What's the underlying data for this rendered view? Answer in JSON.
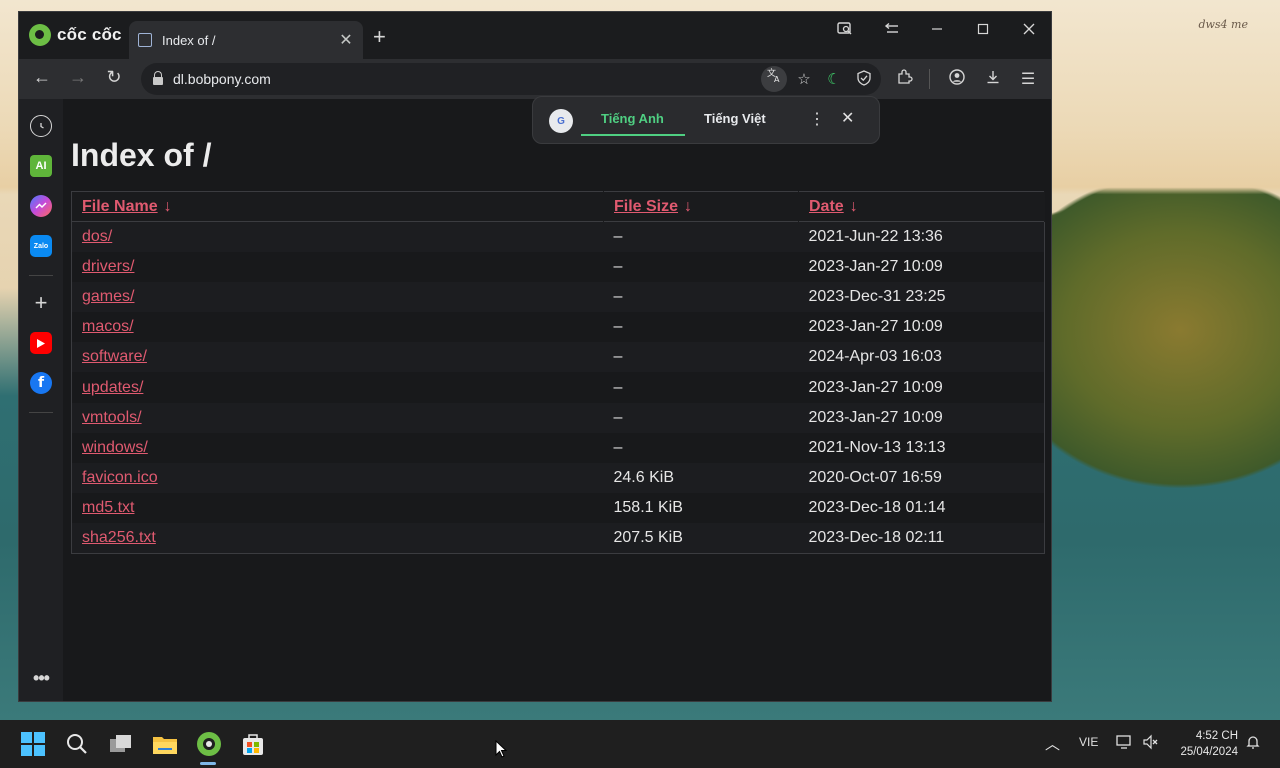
{
  "desktop": {
    "watermark": "dws4 me"
  },
  "browser": {
    "brand": "cốc cốc",
    "tab": {
      "title": "Index of /",
      "close": "✕"
    },
    "new_tab": "+",
    "url": "dl.bobpony.com"
  },
  "translate_popup": {
    "logo": "G",
    "tabs": [
      {
        "label": "Tiếng Anh",
        "active": true
      },
      {
        "label": "Tiếng Việt",
        "active": false
      }
    ]
  },
  "sidebar": {
    "ai_label": "AI",
    "zalo_label": "Zalo"
  },
  "page": {
    "title": "Index of /",
    "columns": [
      {
        "label": "File Name",
        "sort": "↓"
      },
      {
        "label": "File Size",
        "sort": "↓"
      },
      {
        "label": "Date",
        "sort": "↓"
      }
    ],
    "rows": [
      {
        "name": "dos/",
        "size": "–",
        "date": "2021-Jun-22 13:36"
      },
      {
        "name": "drivers/",
        "size": "–",
        "date": "2023-Jan-27 10:09"
      },
      {
        "name": "games/",
        "size": "–",
        "date": "2023-Dec-31 23:25"
      },
      {
        "name": "macos/",
        "size": "–",
        "date": "2023-Jan-27 10:09"
      },
      {
        "name": "software/",
        "size": "–",
        "date": "2024-Apr-03 16:03"
      },
      {
        "name": "updates/",
        "size": "–",
        "date": "2023-Jan-27 10:09"
      },
      {
        "name": "vmtools/",
        "size": "–",
        "date": "2023-Jan-27 10:09"
      },
      {
        "name": "windows/",
        "size": "–",
        "date": "2021-Nov-13 13:13"
      },
      {
        "name": "favicon.ico",
        "size": "24.6 KiB",
        "date": "2020-Oct-07 16:59"
      },
      {
        "name": "md5.txt",
        "size": "158.1 KiB",
        "date": "2023-Dec-18 01:14"
      },
      {
        "name": "sha256.txt",
        "size": "207.5 KiB",
        "date": "2023-Dec-18 02:11"
      }
    ]
  },
  "taskbar": {
    "language": "VIE",
    "time": "4:52 CH",
    "date": "25/04/2024"
  },
  "colors": {
    "link": "#e05a70",
    "translate_active": "#4fcf82",
    "page_bg": "#18191b"
  }
}
